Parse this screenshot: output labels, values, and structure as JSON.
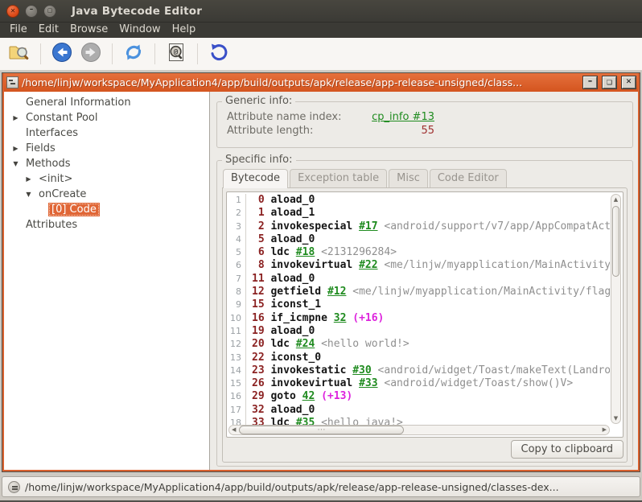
{
  "app": {
    "title": "Java Bytecode Editor"
  },
  "menu": {
    "items": [
      "File",
      "Edit",
      "Browse",
      "Window",
      "Help"
    ]
  },
  "toolbar": {
    "buttons": [
      {
        "name": "open-class",
        "icon": "folder-search-icon",
        "enabled": true
      },
      {
        "name": "back",
        "icon": "back-arrow-icon",
        "enabled": true
      },
      {
        "name": "forward",
        "icon": "forward-arrow-icon",
        "enabled": false
      },
      {
        "name": "reload",
        "icon": "reload-icon",
        "enabled": true
      },
      {
        "name": "find",
        "icon": "find-in-file-icon",
        "enabled": true
      },
      {
        "name": "revert",
        "icon": "revert-icon",
        "enabled": true
      }
    ]
  },
  "frame": {
    "title": "/home/linjw/workspace/MyApplication4/app/build/outputs/apk/release/app-release-unsigned/class..."
  },
  "icons": {
    "collapsed": "▶",
    "expanded": "▼",
    "leaf": ""
  },
  "tree": {
    "items": [
      {
        "label": "General Information",
        "level": 0,
        "state": "leaf",
        "selected": false
      },
      {
        "label": "Constant Pool",
        "level": 0,
        "state": "collapsed",
        "selected": false
      },
      {
        "label": "Interfaces",
        "level": 0,
        "state": "leaf",
        "selected": false
      },
      {
        "label": "Fields",
        "level": 0,
        "state": "collapsed",
        "selected": false
      },
      {
        "label": "Methods",
        "level": 0,
        "state": "expanded",
        "selected": false
      },
      {
        "label": "<init>",
        "level": 1,
        "state": "collapsed",
        "selected": false
      },
      {
        "label": "onCreate",
        "level": 1,
        "state": "expanded",
        "selected": false
      },
      {
        "label": "[0] Code",
        "level": 2,
        "state": "leaf",
        "selected": true
      },
      {
        "label": "Attributes",
        "level": 0,
        "state": "leaf",
        "selected": false
      }
    ]
  },
  "generic_info": {
    "legend": "Generic info:",
    "rows": [
      {
        "label": "Attribute name index:",
        "value": "cp_info #13",
        "kind": "link"
      },
      {
        "label": "Attribute length:",
        "value": "55",
        "kind": "number"
      }
    ]
  },
  "specific_info": {
    "legend": "Specific info:",
    "tabs": [
      {
        "label": "Bytecode",
        "active": true
      },
      {
        "label": "Exception table",
        "active": false
      },
      {
        "label": "Misc",
        "active": false
      },
      {
        "label": "Code Editor",
        "active": false
      }
    ],
    "copy_button_label": "Copy to clipboard"
  },
  "bytecode": {
    "lines": [
      {
        "num": 1,
        "offset": "0",
        "opcode": "aload_0",
        "link": null,
        "branch": null,
        "comment": null
      },
      {
        "num": 2,
        "offset": "1",
        "opcode": "aload_1",
        "link": null,
        "branch": null,
        "comment": null
      },
      {
        "num": 3,
        "offset": "2",
        "opcode": "invokespecial",
        "link": "#17",
        "branch": null,
        "comment": "<android/support/v7/app/AppCompatAct"
      },
      {
        "num": 4,
        "offset": "5",
        "opcode": "aload_0",
        "link": null,
        "branch": null,
        "comment": null
      },
      {
        "num": 5,
        "offset": "6",
        "opcode": "ldc",
        "link": "#18",
        "branch": null,
        "comment": "<2131296284>"
      },
      {
        "num": 6,
        "offset": "8",
        "opcode": "invokevirtual",
        "link": "#22",
        "branch": null,
        "comment": "<me/linjw/myapplication/MainActivity"
      },
      {
        "num": 7,
        "offset": "11",
        "opcode": "aload_0",
        "link": null,
        "branch": null,
        "comment": null
      },
      {
        "num": 8,
        "offset": "12",
        "opcode": "getfield",
        "link": "#12",
        "branch": null,
        "comment": "<me/linjw/myapplication/MainActivity/flag"
      },
      {
        "num": 9,
        "offset": "15",
        "opcode": "iconst_1",
        "link": null,
        "branch": null,
        "comment": null
      },
      {
        "num": 10,
        "offset": "16",
        "opcode": "if_icmpne",
        "link": "32",
        "branch": "(+16)",
        "comment": null
      },
      {
        "num": 11,
        "offset": "19",
        "opcode": "aload_0",
        "link": null,
        "branch": null,
        "comment": null
      },
      {
        "num": 12,
        "offset": "20",
        "opcode": "ldc",
        "link": "#24",
        "branch": null,
        "comment": "<hello world!>"
      },
      {
        "num": 13,
        "offset": "22",
        "opcode": "iconst_0",
        "link": null,
        "branch": null,
        "comment": null
      },
      {
        "num": 14,
        "offset": "23",
        "opcode": "invokestatic",
        "link": "#30",
        "branch": null,
        "comment": "<android/widget/Toast/makeText(Landro"
      },
      {
        "num": 15,
        "offset": "26",
        "opcode": "invokevirtual",
        "link": "#33",
        "branch": null,
        "comment": "<android/widget/Toast/show()V>"
      },
      {
        "num": 16,
        "offset": "29",
        "opcode": "goto",
        "link": "42",
        "branch": "(+13)",
        "comment": null
      },
      {
        "num": 17,
        "offset": "32",
        "opcode": "aload_0",
        "link": null,
        "branch": null,
        "comment": null
      },
      {
        "num": 18,
        "offset": "33",
        "opcode": "ldc",
        "link": "#35",
        "branch": null,
        "comment": "<hello java!>"
      }
    ]
  },
  "status_bar": {
    "path": "/home/linjw/workspace/MyApplication4/app/build/outputs/apk/release/app-release-unsigned/classes-dex..."
  },
  "colors": {
    "frame_accent": "#D8602E",
    "selection_orange": "#E06636",
    "link_green": "#1F8B1F",
    "offset_maroon": "#8B2222",
    "branch_magenta": "#DD22DD",
    "comment_gray": "#8F8F8F",
    "value_red": "#A03030"
  }
}
